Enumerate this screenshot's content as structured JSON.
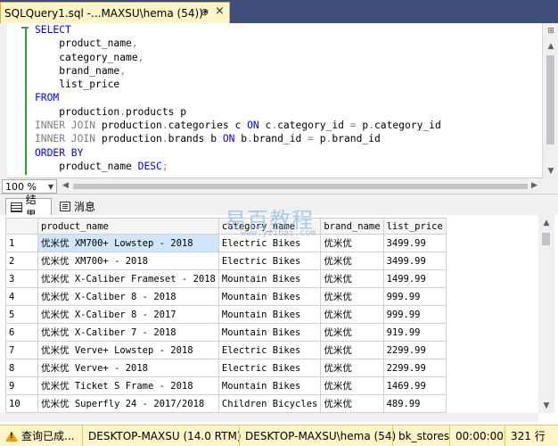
{
  "tab": {
    "title": "SQLQuery1.sql -...MAXSU\\hema (54))*",
    "pin_glyph": "⊕",
    "close_glyph": "×"
  },
  "editor": {
    "lines": [
      {
        "indent": "",
        "parts": [
          {
            "t": "SELECT",
            "c": "kw"
          }
        ]
      },
      {
        "indent": "    ",
        "parts": [
          {
            "t": "product_name",
            "c": ""
          },
          {
            "t": ",",
            "c": "gr"
          }
        ]
      },
      {
        "indent": "    ",
        "parts": [
          {
            "t": "category_name",
            "c": ""
          },
          {
            "t": ",",
            "c": "gr"
          }
        ]
      },
      {
        "indent": "    ",
        "parts": [
          {
            "t": "brand_name",
            "c": ""
          },
          {
            "t": ",",
            "c": "gr"
          }
        ]
      },
      {
        "indent": "    ",
        "parts": [
          {
            "t": "list_price",
            "c": ""
          }
        ]
      },
      {
        "indent": "",
        "parts": [
          {
            "t": "FROM",
            "c": "kw"
          }
        ]
      },
      {
        "indent": "    ",
        "parts": [
          {
            "t": "production",
            "c": ""
          },
          {
            "t": ".",
            "c": "gr"
          },
          {
            "t": "products p",
            "c": ""
          }
        ]
      },
      {
        "indent": "",
        "parts": [
          {
            "t": "INNER JOIN",
            "c": "gr"
          },
          {
            "t": " production",
            "c": ""
          },
          {
            "t": ".",
            "c": "gr"
          },
          {
            "t": "categories c ",
            "c": ""
          },
          {
            "t": "ON",
            "c": "kw"
          },
          {
            "t": " c",
            "c": ""
          },
          {
            "t": ".",
            "c": "gr"
          },
          {
            "t": "category_id ",
            "c": ""
          },
          {
            "t": "=",
            "c": "gr"
          },
          {
            "t": " p",
            "c": ""
          },
          {
            "t": ".",
            "c": "gr"
          },
          {
            "t": "category_id",
            "c": ""
          }
        ]
      },
      {
        "indent": "",
        "parts": [
          {
            "t": "INNER JOIN",
            "c": "gr"
          },
          {
            "t": " production",
            "c": ""
          },
          {
            "t": ".",
            "c": "gr"
          },
          {
            "t": "brands b ",
            "c": ""
          },
          {
            "t": "ON",
            "c": "kw"
          },
          {
            "t": " b",
            "c": ""
          },
          {
            "t": ".",
            "c": "gr"
          },
          {
            "t": "brand_id ",
            "c": ""
          },
          {
            "t": "=",
            "c": "gr"
          },
          {
            "t": " p",
            "c": ""
          },
          {
            "t": ".",
            "c": "gr"
          },
          {
            "t": "brand_id",
            "c": ""
          }
        ]
      },
      {
        "indent": "",
        "parts": [
          {
            "t": "ORDER BY",
            "c": "kw"
          }
        ]
      },
      {
        "indent": "    ",
        "parts": [
          {
            "t": "product_name ",
            "c": ""
          },
          {
            "t": "DESC",
            "c": "kw"
          },
          {
            "t": ";",
            "c": "gr"
          }
        ]
      }
    ]
  },
  "zoom": {
    "value": "100 %"
  },
  "results_tabs": [
    {
      "label": "结果"
    },
    {
      "label": "消息"
    }
  ],
  "watermark": {
    "text": "易百教程",
    "sub": "www.yiibai.com"
  },
  "grid": {
    "columns": [
      "",
      "product_name",
      "category_name",
      "brand_name",
      "list_price"
    ],
    "rows": [
      [
        "1",
        "优米优 XM700+ Lowstep - 2018",
        "Electric Bikes",
        "优米优",
        "3499.99"
      ],
      [
        "2",
        "优米优 XM700+ - 2018",
        "Electric Bikes",
        "优米优",
        "3499.99"
      ],
      [
        "3",
        "优米优 X-Caliber Frameset - 2018",
        "Mountain Bikes",
        "优米优",
        "1499.99"
      ],
      [
        "4",
        "优米优 X-Caliber 8 - 2018",
        "Mountain Bikes",
        "优米优",
        "999.99"
      ],
      [
        "5",
        "优米优 X-Caliber 8 - 2017",
        "Mountain Bikes",
        "优米优",
        "999.99"
      ],
      [
        "6",
        "优米优 X-Caliber 7 - 2018",
        "Mountain Bikes",
        "优米优",
        "919.99"
      ],
      [
        "7",
        "优米优 Verve+ Lowstep - 2018",
        "Electric Bikes",
        "优米优",
        "2299.99"
      ],
      [
        "8",
        "优米优 Verve+ - 2018",
        "Electric Bikes",
        "优米优",
        "2299.99"
      ],
      [
        "9",
        "优米优 Ticket S Frame - 2018",
        "Mountain Bikes",
        "优米优",
        "1469.99"
      ],
      [
        "10",
        "优米优 Superfly 24 - 2017/2018",
        "Children Bicycles",
        "优米优",
        "489.99"
      ]
    ]
  },
  "status": {
    "message": "查询已成...",
    "server": "DESKTOP-MAXSU (14.0 RTM)",
    "login": "DESKTOP-MAXSU\\hema (54)",
    "database": "bk_stores",
    "elapsed": "00:00:00",
    "rows": "321 行"
  },
  "colors": {
    "tab_bg": "#3f4f7c",
    "status_bg": "#fff5c8",
    "keyword": "#0000ff",
    "selected_cell": "#cfe6fb"
  }
}
